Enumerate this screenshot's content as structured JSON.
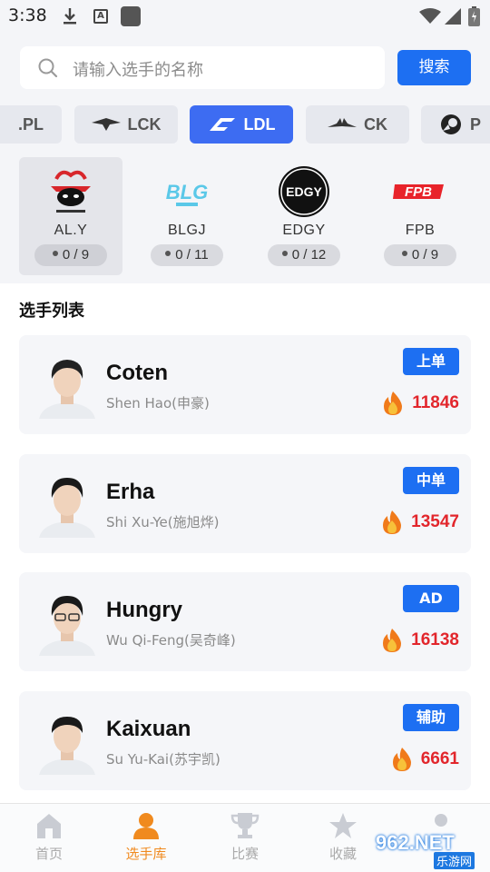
{
  "status_bar": {
    "time": "3:38",
    "app_icon_letter": "A"
  },
  "search": {
    "placeholder": "请输入选手的名称",
    "button_label": "搜索"
  },
  "leagues": [
    {
      "label": ".PL",
      "icon": "league-pl-icon",
      "active": false
    },
    {
      "label": "LCK",
      "icon": "lck-logo-icon",
      "active": false
    },
    {
      "label": "LDL",
      "icon": "ldl-logo-icon",
      "active": true
    },
    {
      "label": "CK",
      "icon": "ck-logo-icon",
      "active": false
    },
    {
      "label": "P",
      "icon": "league-p-logo-icon",
      "active": false
    }
  ],
  "teams": [
    {
      "name": "AL.Y",
      "count": "0 / 9",
      "selected": true
    },
    {
      "name": "BLGJ",
      "count": "0 / 11",
      "selected": false
    },
    {
      "name": "EDGY",
      "count": "0 / 12",
      "selected": false
    },
    {
      "name": "FPB",
      "count": "0 / 9",
      "selected": false
    }
  ],
  "section_title": "选手列表",
  "players": [
    {
      "name": "Coten",
      "real_name": "Shen Hao(申豪)",
      "role": "上单",
      "heat": "11846"
    },
    {
      "name": "Erha",
      "real_name": "Shi Xu-Ye(施旭烨)",
      "role": "中单",
      "heat": "13547"
    },
    {
      "name": "Hungry",
      "real_name": "Wu Qi-Feng(吴奇峰)",
      "role": "AD",
      "heat": "16138"
    },
    {
      "name": "Kaixuan",
      "real_name": "Su Yu-Kai(苏宇凯)",
      "role": "辅助",
      "heat": "6661"
    }
  ],
  "bottom_nav": [
    {
      "label": "首页",
      "icon": "home-icon",
      "active": false
    },
    {
      "label": "选手库",
      "icon": "player-icon",
      "active": true
    },
    {
      "label": "比赛",
      "icon": "trophy-icon",
      "active": false
    },
    {
      "label": "收藏",
      "icon": "star-icon",
      "active": false
    }
  ],
  "watermark": {
    "text": "962.NET",
    "sub": "乐游网"
  },
  "colors": {
    "primary": "#1d6ff2",
    "league_active": "#3d6cf2",
    "heat": "#e2262c",
    "nav_active": "#f08a1e"
  }
}
